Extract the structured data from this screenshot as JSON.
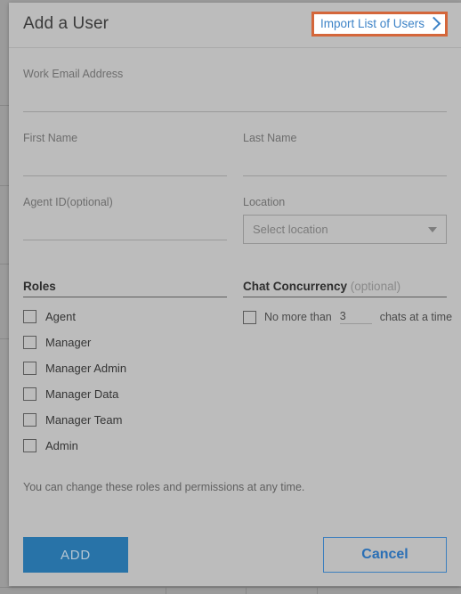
{
  "dialog": {
    "title": "Add a User",
    "import_link": {
      "label": "Import List of Users",
      "icon": "chevron-right-icon",
      "focus_ring_color": "#d4663a",
      "link_color": "#3d83c7"
    }
  },
  "fields": {
    "email": {
      "label": "Work Email Address",
      "value": "",
      "placeholder": ""
    },
    "first_name": {
      "label": "First Name",
      "value": "",
      "placeholder": ""
    },
    "last_name": {
      "label": "Last Name",
      "value": "",
      "placeholder": ""
    },
    "agent_id": {
      "label": "Agent ID(optional)",
      "value": "",
      "placeholder": ""
    },
    "location": {
      "label": "Location",
      "selected": "Select location",
      "icon": "caret-down-icon"
    }
  },
  "roles": {
    "heading": "Roles",
    "items": [
      {
        "label": "Agent",
        "checked": false
      },
      {
        "label": "Manager",
        "checked": false
      },
      {
        "label": "Manager Admin",
        "checked": false
      },
      {
        "label": "Manager Data",
        "checked": false
      },
      {
        "label": "Manager Team",
        "checked": false
      },
      {
        "label": "Admin",
        "checked": false
      }
    ]
  },
  "chat_concurrency": {
    "heading": "Chat Concurrency",
    "optional_tag": "(optional)",
    "checked": false,
    "prefix_text": "No more than",
    "value": "3",
    "suffix_text": "chats at a time"
  },
  "note": "You can change these roles and permissions at any time.",
  "footer": {
    "add_label": "ADD",
    "cancel_label": "Cancel",
    "add_color": "#2873a8",
    "cancel_color": "#2a6fb5"
  }
}
